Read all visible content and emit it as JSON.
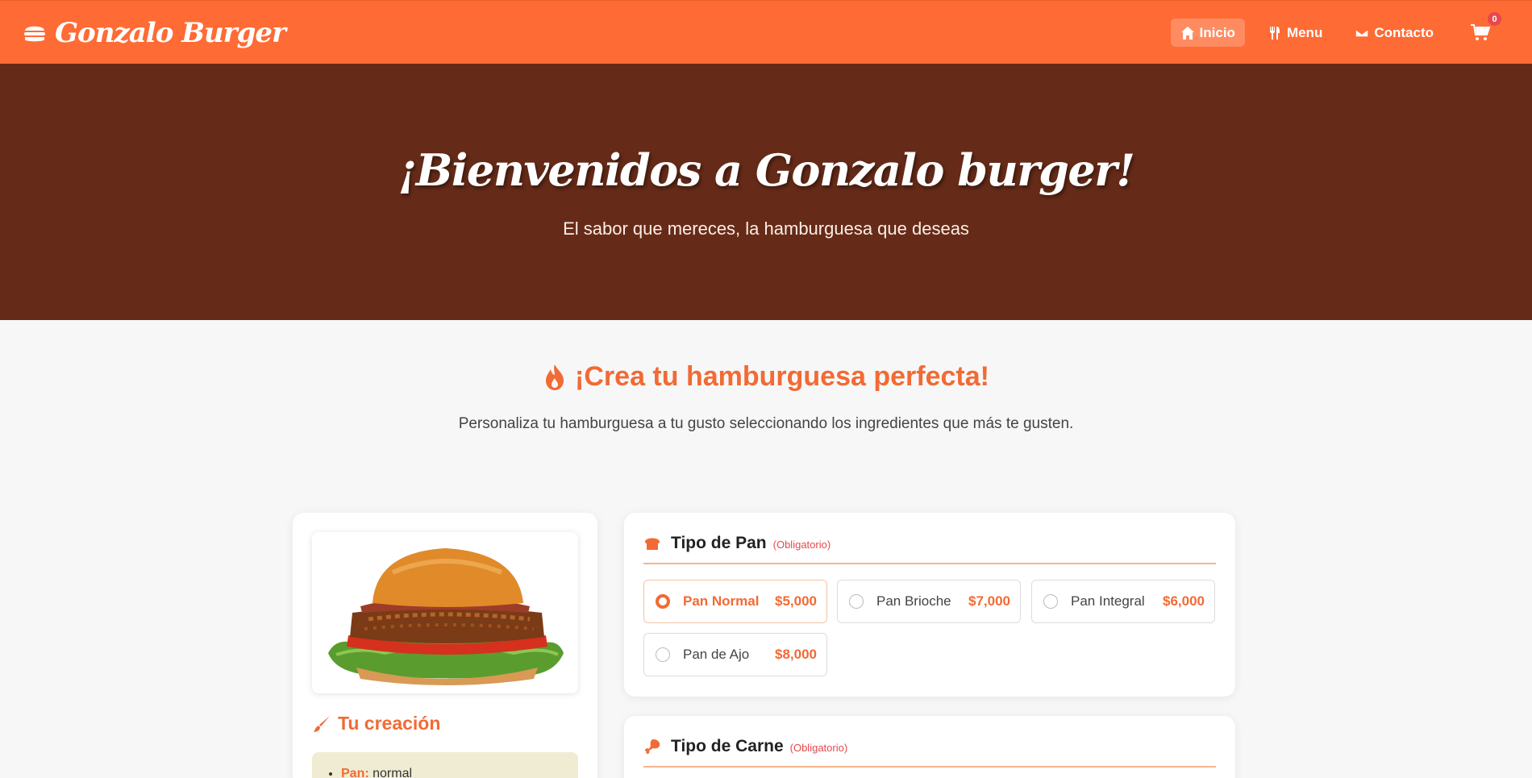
{
  "brand": {
    "name": "Gonzalo Burger",
    "icon": "burger-icon"
  },
  "nav": {
    "items": [
      {
        "label": "Inicio",
        "icon": "home-icon",
        "active": true
      },
      {
        "label": "Menu",
        "icon": "utensils-icon",
        "active": false
      },
      {
        "label": "Contacto",
        "icon": "envelope-icon",
        "active": false
      }
    ],
    "cart_count": "0"
  },
  "hero": {
    "title": "¡Bienvenidos a Gonzalo burger!",
    "subtitle": "El sabor que mereces, la hamburguesa que deseas"
  },
  "builder": {
    "title": "¡Crea tu hamburguesa perfecta!",
    "subtitle": "Personaliza tu hamburguesa a tu gusto seleccionando los ingredientes que más te gusten."
  },
  "creation": {
    "title": "Tu creación",
    "summary": [
      {
        "key": "Pan:",
        "value": "normal"
      }
    ]
  },
  "sections": {
    "pan": {
      "title": "Tipo de Pan",
      "required": "(Obligatorio)",
      "options": [
        {
          "name": "Pan Normal",
          "price": "$5,000",
          "selected": true
        },
        {
          "name": "Pan Brioche",
          "price": "$7,000",
          "selected": false
        },
        {
          "name": "Pan Integral",
          "price": "$6,000",
          "selected": false
        },
        {
          "name": "Pan de Ajo",
          "price": "$8,000",
          "selected": false
        }
      ]
    },
    "carne": {
      "title": "Tipo de Carne",
      "required": "(Obligatorio)"
    }
  },
  "colors": {
    "primary": "#ff6b35",
    "hero_bg": "#662b18",
    "accent": "#f26a34",
    "summary_bg": "#efecd3"
  }
}
